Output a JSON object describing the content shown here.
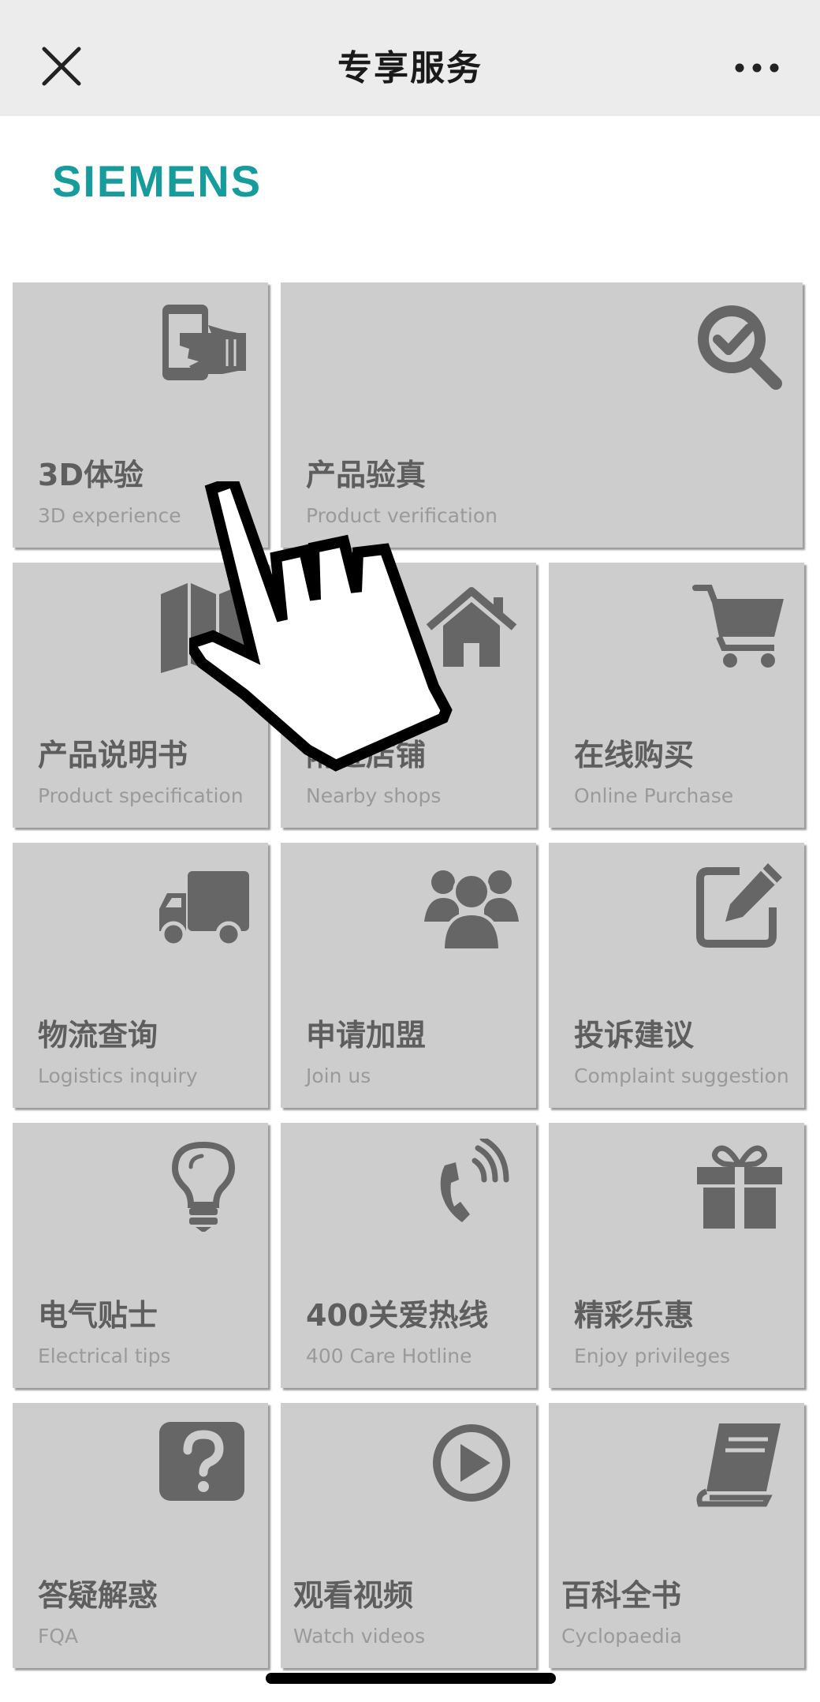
{
  "header": {
    "title": "专享服务",
    "close_icon": "close-icon",
    "more_icon": "more-horizontal-icon"
  },
  "brand": {
    "name": "SIEMENS",
    "color": "#179c9e"
  },
  "tiles": [
    {
      "cn": "3D体验",
      "en": "3D experience",
      "icon": "phone-hand-icon"
    },
    {
      "cn": "产品验真",
      "en": "Product verification",
      "icon": "magnifier-check-icon"
    },
    {
      "cn": "产品说明书",
      "en": "Product specification",
      "icon": "map-icon"
    },
    {
      "cn": "附近店铺",
      "en": "Nearby shops",
      "icon": "home-icon"
    },
    {
      "cn": "在线购买",
      "en": "Online Purchase",
      "icon": "cart-icon"
    },
    {
      "cn": "物流查询",
      "en": "Logistics inquiry",
      "icon": "truck-icon"
    },
    {
      "cn": "申请加盟",
      "en": "Join us",
      "icon": "group-icon"
    },
    {
      "cn": "投诉建议",
      "en": "Complaint suggestion",
      "icon": "edit-icon"
    },
    {
      "cn": "电气贴士",
      "en": "Electrical tips",
      "icon": "lightbulb-icon"
    },
    {
      "cn": "400关爱热线",
      "en": "400 Care Hotline",
      "icon": "phone-icon"
    },
    {
      "cn": "精彩乐惠",
      "en": "Enjoy privileges",
      "icon": "gift-icon"
    },
    {
      "cn": "答疑解惑",
      "en": "FQA",
      "icon": "question-icon"
    },
    {
      "cn": "观看视频",
      "en": "Watch videos",
      "icon": "play-icon"
    },
    {
      "cn": "百科全书",
      "en": "Cyclopaedia",
      "icon": "book-icon"
    }
  ],
  "colors": {
    "tile_bg": "#cdcdcd",
    "tile_icon": "#666666",
    "title_text": "#5e5e5e",
    "subtitle_text": "#9a9a9a",
    "topbar_bg": "#ececec"
  }
}
